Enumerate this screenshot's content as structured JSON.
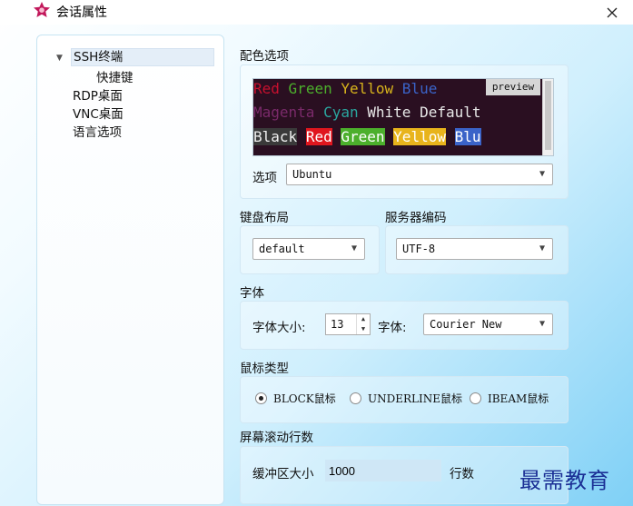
{
  "window": {
    "title": "会话属性"
  },
  "tree": {
    "items": [
      {
        "label": "SSH终端"
      },
      {
        "label": "快捷键"
      },
      {
        "label": "RDP桌面"
      },
      {
        "label": "VNC桌面"
      },
      {
        "label": "语言选项"
      }
    ]
  },
  "color_options": {
    "label": "配色选项",
    "preview_badge": "preview",
    "rows": [
      [
        {
          "text": "Red",
          "fg": "#c8102e",
          "bg": ""
        },
        {
          "text": " "
        },
        {
          "text": "Green",
          "fg": "#4caf2c",
          "bg": ""
        },
        {
          "text": " "
        },
        {
          "text": "Yellow",
          "fg": "#d8b41c",
          "bg": ""
        },
        {
          "text": " "
        },
        {
          "text": "Blue",
          "fg": "#3a63c8",
          "bg": ""
        }
      ],
      [
        {
          "text": "Magenta",
          "fg": "#7a2a6a",
          "bg": ""
        },
        {
          "text": " "
        },
        {
          "text": "Cyan",
          "fg": "#2aa7a0",
          "bg": ""
        },
        {
          "text": " "
        },
        {
          "text": "White",
          "fg": "#e8e8e8",
          "bg": ""
        },
        {
          "text": " "
        },
        {
          "text": "Default",
          "fg": "#e8e8e8",
          "bg": ""
        }
      ],
      [
        {
          "text": "Black",
          "fg": "#f0f0f0",
          "bg": "#3a3a3a"
        },
        {
          "text": " "
        },
        {
          "text": "Red",
          "fg": "#ffffff",
          "bg": "#e0161e"
        },
        {
          "text": " "
        },
        {
          "text": "Green",
          "fg": "#ffffff",
          "bg": "#4caf2c"
        },
        {
          "text": " "
        },
        {
          "text": "Yellow",
          "fg": "#ffffff",
          "bg": "#e8b41c"
        },
        {
          "text": " "
        },
        {
          "text": "Blu",
          "fg": "#ffffff",
          "bg": "#3a63c8"
        }
      ]
    ],
    "scheme_label": "选项",
    "scheme_value": "Ubuntu"
  },
  "keyboard": {
    "label": "键盘布局",
    "value": "default"
  },
  "encoding": {
    "label": "服务器编码",
    "value": "UTF-8"
  },
  "font": {
    "label": "字体",
    "size_label": "字体大小:",
    "size_value": "13",
    "family_label": "字体:",
    "family_value": "Courier New"
  },
  "mouse": {
    "label": "鼠标类型",
    "options": [
      {
        "label": "BLOCK鼠标",
        "selected": true
      },
      {
        "label": "UNDERLINE鼠标",
        "selected": false
      },
      {
        "label": "IBEAM鼠标",
        "selected": false
      }
    ]
  },
  "scroll": {
    "label": "屏幕滚动行数",
    "buffer_label": "缓冲区大小",
    "buffer_value": "1000",
    "unit": "行数"
  },
  "watermark": "最需教育",
  "colors": {
    "tree_selected": "#e4eef8",
    "accent": "#7fd0f6",
    "preview_bg": "#2a0f21"
  }
}
